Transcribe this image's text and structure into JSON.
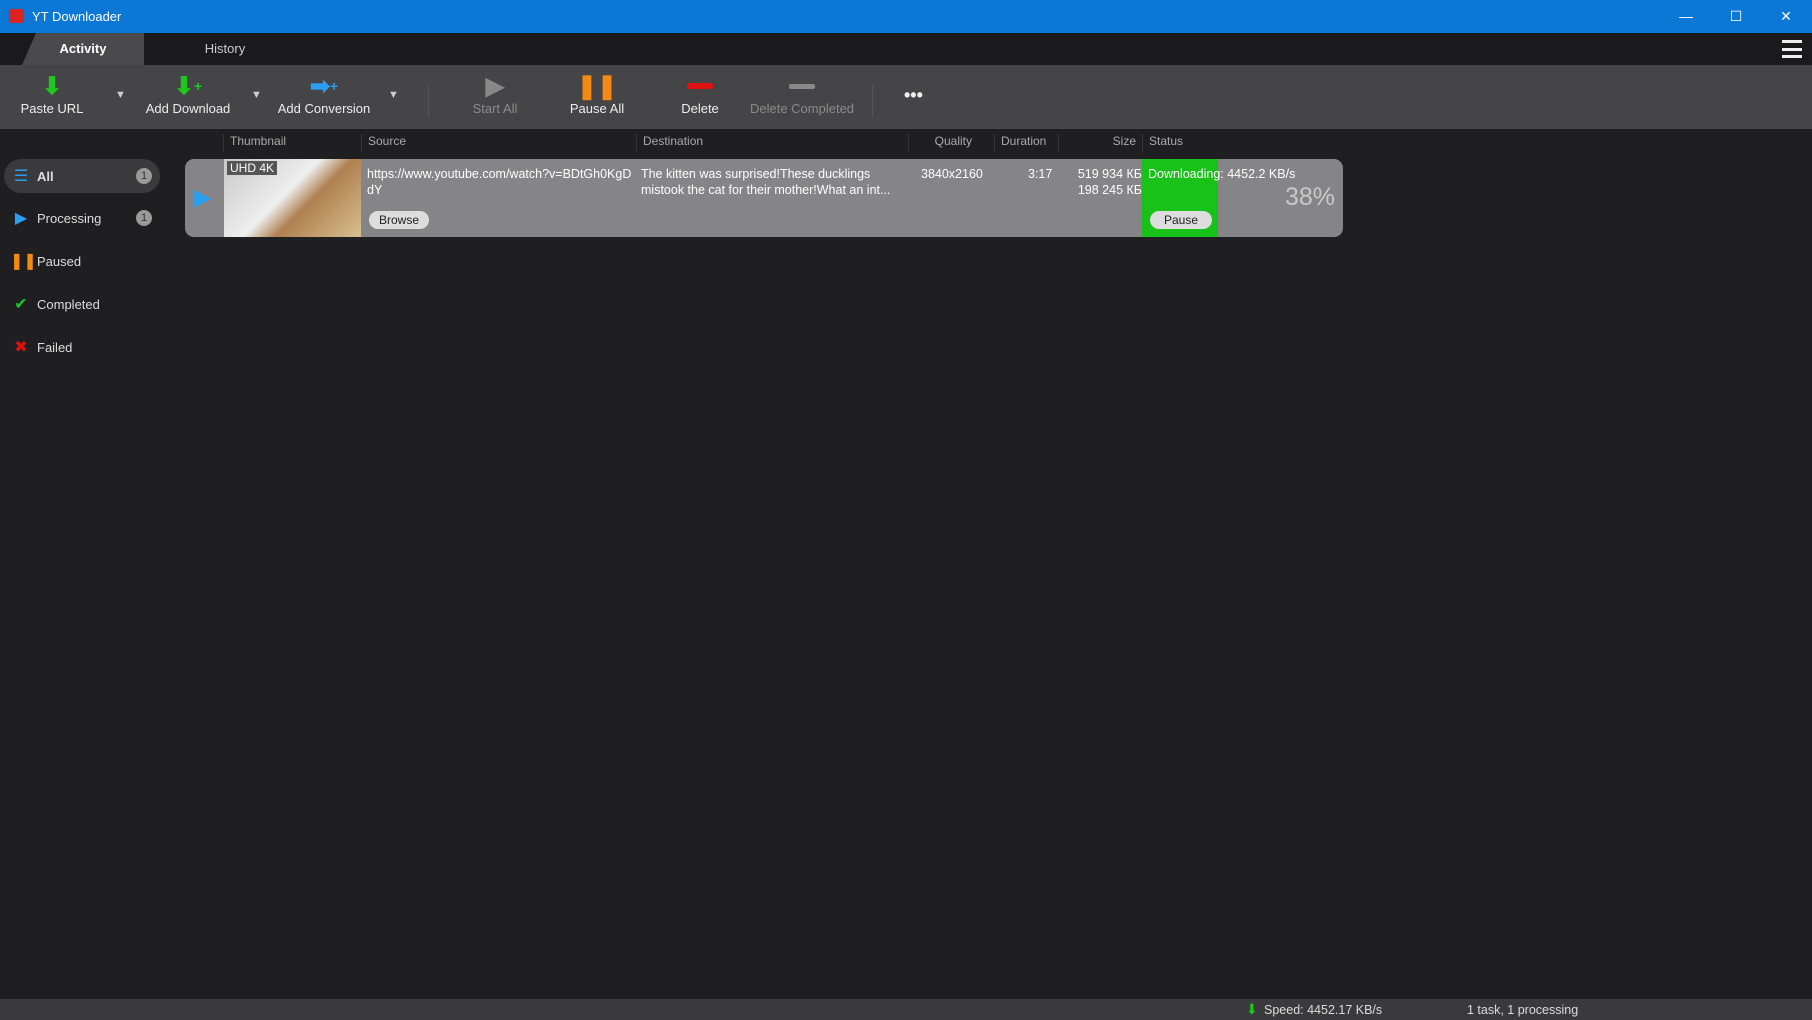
{
  "window": {
    "title": "YT Downloader",
    "minimize": "—",
    "maximize": "☐",
    "close": "✕"
  },
  "tabs": [
    {
      "label": "Activity"
    },
    {
      "label": "History"
    }
  ],
  "toolbar": {
    "paste_url": "Paste URL",
    "add_download": "Add Download",
    "add_conversion": "Add Conversion",
    "start_all": "Start All",
    "pause_all": "Pause All",
    "delete": "Delete",
    "delete_completed": "Delete Completed",
    "more": "•••"
  },
  "columns": [
    "Thumbnail",
    "Source",
    "Destination",
    "Quality",
    "Duration",
    "Size",
    "Status"
  ],
  "sidebar": [
    {
      "label": "All",
      "count": "1"
    },
    {
      "label": "Processing",
      "count": "1"
    },
    {
      "label": "Paused"
    },
    {
      "label": "Completed"
    },
    {
      "label": "Failed"
    }
  ],
  "row": {
    "badge": "UHD 4K",
    "source": "https://www.youtube.com/watch?v=BDtGh0KgDdY",
    "browse": "Browse",
    "destination": "The kitten was surprised!These ducklings mistook the cat for their mother!What an int...",
    "quality": "3840x2160",
    "duration": "3:17",
    "size_total": "519 934 КБ",
    "size_done": "198 245 КБ",
    "status": "Downloading: 4452.2 KB/s",
    "pause": "Pause",
    "percent": "38%",
    "progress": 38
  },
  "statusbar": {
    "speed": "Speed: 4452.17 KB/s",
    "tasks": "1 task, 1 processing"
  },
  "colors": {
    "accent": "#0a78d4",
    "progress": "#19c219"
  }
}
